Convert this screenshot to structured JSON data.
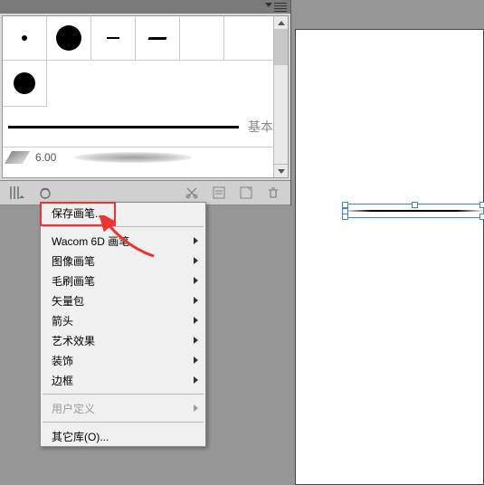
{
  "stroke_preview": {
    "label": "基本",
    "width_value": "6.00"
  },
  "menu": {
    "save_brush": "保存画笔...",
    "wacom": "Wacom 6D 画笔",
    "image_brush": "图像画笔",
    "bristle_brush": "毛刷画笔",
    "vector_pack": "矢量包",
    "arrows": "箭头",
    "art_effect": "艺术效果",
    "decorative": "装饰",
    "border": "边框",
    "user_defined": "用户定义",
    "other_lib": "其它库(O)..."
  }
}
